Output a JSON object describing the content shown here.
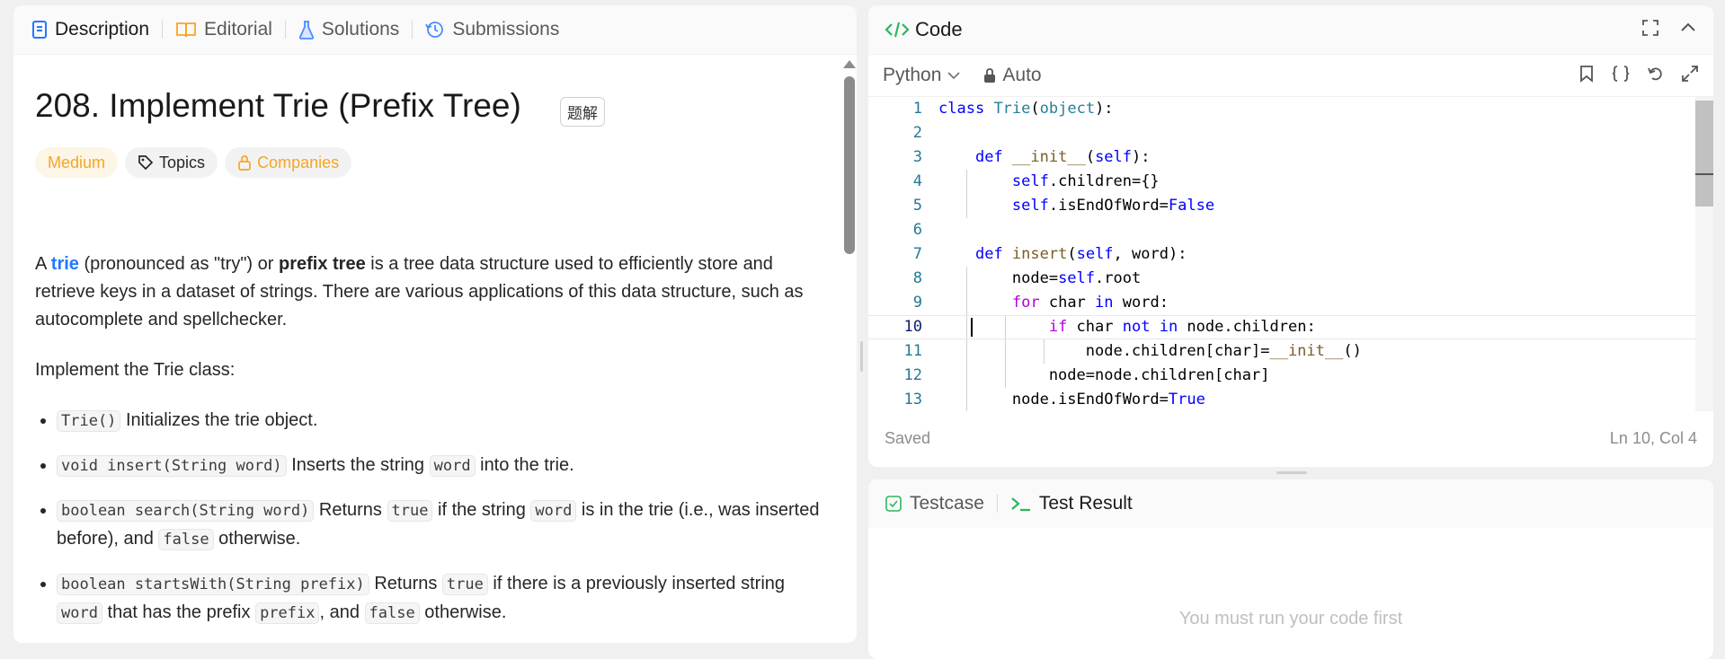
{
  "left_panel": {
    "tabs": [
      {
        "label": "Description",
        "icon": "description-icon"
      },
      {
        "label": "Editorial",
        "icon": "book-icon"
      },
      {
        "label": "Solutions",
        "icon": "flask-icon"
      },
      {
        "label": "Submissions",
        "icon": "history-icon"
      }
    ],
    "title": "208. Implement Trie (Prefix Tree)",
    "title_button": "题解",
    "tags": {
      "difficulty": "Medium",
      "topics": "Topics",
      "companies": "Companies"
    },
    "paragraph1": {
      "a": "A ",
      "trie": "trie",
      "b": " (pronounced as \"try\") or ",
      "prefix_tree": "prefix tree",
      "c": " is a tree data structure used to efficiently store and retrieve keys in a dataset of strings. There are various applications of this data structure, such as autocomplete and spellchecker."
    },
    "paragraph2": "Implement the Trie class:",
    "items": [
      {
        "code": "Trie()",
        "text": " Initializes the trie object."
      },
      {
        "code": "void insert(String word)",
        "text1": " Inserts the string ",
        "code2": "word",
        "text2": " into the trie."
      },
      {
        "code": "boolean search(String word)",
        "text1": " Returns ",
        "code2": "true",
        "text2": " if the string ",
        "code3": "word",
        "text3": " is in the trie (i.e., was inserted before), and ",
        "code4": "false",
        "text4": " otherwise."
      },
      {
        "code": "boolean startsWith(String prefix)",
        "text1": " Returns ",
        "code2": "true",
        "text2": " if there is a previously inserted string ",
        "code3": "word",
        "text3": " that has the prefix ",
        "code4": "prefix",
        "text4": ", and ",
        "code5": "false",
        "text5": " otherwise."
      }
    ]
  },
  "code_panel": {
    "title": "Code",
    "language": "Python",
    "mode": "Auto",
    "status": "Saved",
    "cursor": "Ln 10, Col 4",
    "lines": [
      "1",
      "2",
      "3",
      "4",
      "5",
      "6",
      "7",
      "8",
      "9",
      "10",
      "11",
      "12",
      "13"
    ]
  },
  "result_panel": {
    "tabs": [
      "Testcase",
      "Test Result"
    ],
    "message": "You must run your code first"
  },
  "colors": {
    "accent_blue": "#2478ff",
    "medium": "#f5a623",
    "green": "#2db55d"
  }
}
